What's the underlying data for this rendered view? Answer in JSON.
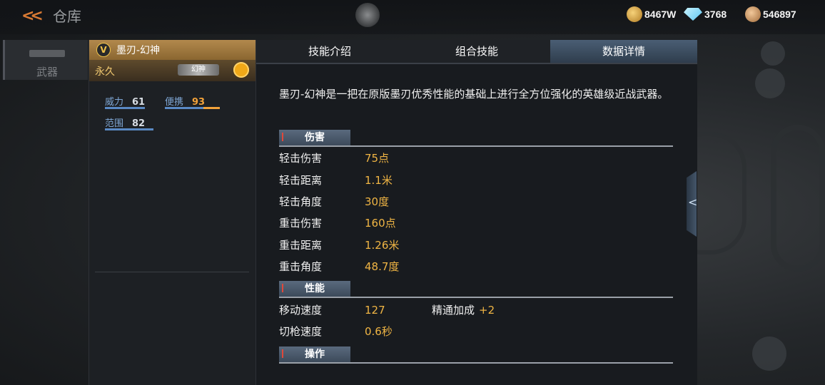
{
  "topbar": {
    "title": "仓库",
    "currencies": [
      {
        "icon": "gold-coin-icon",
        "value": "8467W"
      },
      {
        "icon": "diamond-icon",
        "value": "3768"
      },
      {
        "icon": "token-icon",
        "value": "546897"
      }
    ]
  },
  "rail": {
    "tab_label": "武器"
  },
  "card": {
    "name": "墨刃-幻神",
    "badge": "V",
    "duration": "永久",
    "tag": "幻神",
    "stats": [
      {
        "label": "威力",
        "value": "61",
        "level": 0.61
      },
      {
        "label": "便携",
        "value": "93",
        "level": 0.93
      },
      {
        "label": "范围",
        "value": "82",
        "level": 0.82
      }
    ]
  },
  "panel": {
    "tabs": [
      "技能介绍",
      "组合技能",
      "数据详情"
    ],
    "active_tab": 2,
    "description": "墨刃-幻神是一把在原版墨刃优秀性能的基础上进行全方位强化的英雄级近战武器。",
    "sections": {
      "damage": {
        "title": "伤害",
        "rows": [
          {
            "k": "轻击伤害",
            "v": "75点"
          },
          {
            "k": "轻击距离",
            "v": "1.1米"
          },
          {
            "k": "轻击角度",
            "v": "30度"
          },
          {
            "k": "重击伤害",
            "v": "160点"
          },
          {
            "k": "重击距离",
            "v": "1.26米"
          },
          {
            "k": "重击角度",
            "v": "48.7度"
          }
        ]
      },
      "performance": {
        "title": "性能",
        "rows": [
          {
            "k": "移动速度",
            "v": "127",
            "k2": "精通加成",
            "v2": "+2"
          },
          {
            "k": "切枪速度",
            "v": "0.6秒"
          }
        ]
      },
      "operation": {
        "title": "操作"
      }
    }
  },
  "colors": {
    "accent_gold": "#f0b544",
    "stat_blue": "#5a89c4",
    "stat_orange": "#f2a23a"
  }
}
